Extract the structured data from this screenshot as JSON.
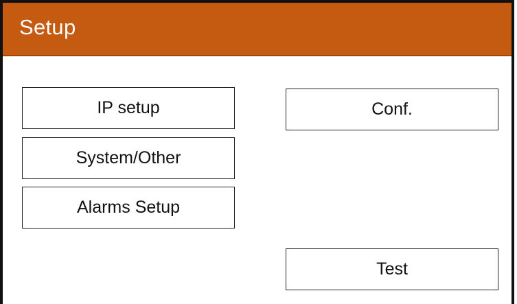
{
  "header": {
    "title": "Setup",
    "background_color": "#c55a11"
  },
  "buttons": {
    "ip_setup": "IP setup",
    "system_other": "System/Other",
    "alarms_setup": "Alarms Setup",
    "conf": "Conf.",
    "test": "Test"
  }
}
